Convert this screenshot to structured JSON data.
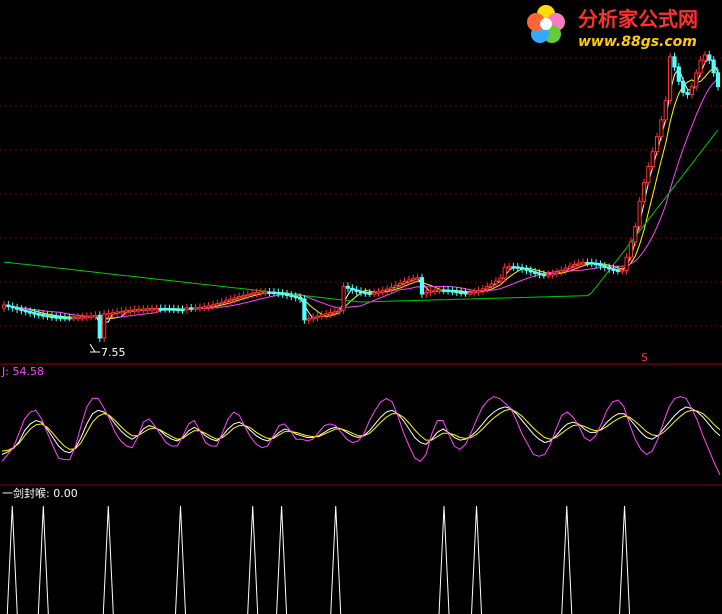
{
  "watermark": {
    "brand": "分析家公式网",
    "url": "www.88gs.com"
  },
  "chart_data": [
    {
      "type": "candlestick",
      "panel": "main",
      "grid": "horizontal dotted red",
      "annotations": [
        {
          "text": "7.55",
          "note": "low marker"
        },
        {
          "text": "S",
          "note": "signal marker"
        }
      ],
      "candles_count": 165,
      "ma_series": [
        {
          "color": "#ffffff"
        },
        {
          "color": "#ffff00"
        },
        {
          "color": "#ff44ff"
        },
        {
          "color": "#00cc00"
        }
      ],
      "colors": {
        "up": "#ff3030",
        "down": "#54ffff"
      }
    },
    {
      "type": "line",
      "panel": "kdj",
      "label": "J: 54.58",
      "series": [
        {
          "color": "#ffffff",
          "values": [
            30,
            33,
            37,
            45,
            58,
            66,
            70,
            68,
            60,
            50,
            40,
            34,
            32,
            38,
            50,
            66,
            78,
            82,
            80,
            75,
            66,
            58,
            52,
            48,
            52,
            60,
            64,
            62,
            58,
            52,
            48,
            46,
            50,
            58,
            62,
            58,
            52,
            48,
            46,
            52,
            60,
            66,
            68,
            64,
            58,
            52,
            48,
            46,
            50,
            56,
            60,
            58,
            54,
            52,
            50,
            50,
            52,
            56,
            60,
            62,
            60,
            56,
            52,
            50,
            52,
            58,
            66,
            74,
            80,
            82,
            78,
            70,
            60,
            50,
            44,
            42,
            48,
            56,
            60,
            56,
            50,
            47,
            48,
            52,
            58,
            66,
            74,
            80,
            84,
            86,
            84,
            78,
            70,
            62,
            54,
            48,
            44,
            46,
            52,
            60,
            66,
            68,
            66,
            60,
            56,
            56,
            60,
            68,
            74,
            78,
            78,
            72,
            64,
            56,
            50,
            48,
            52,
            60,
            68,
            76,
            82,
            86,
            84,
            80,
            74,
            66,
            58,
            52
          ]
        },
        {
          "color": "#ffff00",
          "values": [
            34,
            35,
            38,
            43,
            52,
            60,
            65,
            66,
            62,
            55,
            47,
            40,
            36,
            37,
            44,
            56,
            68,
            75,
            78,
            76,
            70,
            63,
            57,
            52,
            52,
            56,
            60,
            61,
            59,
            55,
            51,
            48,
            49,
            54,
            58,
            58,
            55,
            51,
            48,
            50,
            55,
            61,
            64,
            64,
            61,
            56,
            52,
            49,
            49,
            53,
            57,
            57,
            56,
            54,
            52,
            51,
            51,
            54,
            57,
            60,
            60,
            58,
            55,
            52,
            52,
            55,
            61,
            68,
            74,
            78,
            78,
            74,
            67,
            59,
            52,
            47,
            47,
            51,
            55,
            55,
            53,
            50,
            49,
            50,
            54,
            60,
            67,
            73,
            78,
            82,
            83,
            80,
            75,
            68,
            61,
            55,
            50,
            48,
            50,
            55,
            60,
            64,
            65,
            63,
            60,
            58,
            59,
            63,
            68,
            72,
            75,
            74,
            69,
            63,
            57,
            53,
            52,
            56,
            62,
            69,
            75,
            80,
            82,
            81,
            78,
            72,
            65,
            59
          ]
        },
        {
          "color": "#ff44ff",
          "values": [
            22,
            30,
            38,
            55,
            72,
            80,
            82,
            72,
            56,
            40,
            26,
            24,
            24,
            40,
            64,
            86,
            96,
            96,
            85,
            72,
            56,
            46,
            40,
            38,
            50,
            68,
            72,
            64,
            54,
            44,
            40,
            40,
            52,
            66,
            70,
            58,
            44,
            40,
            40,
            56,
            72,
            80,
            76,
            62,
            50,
            42,
            38,
            40,
            52,
            64,
            66,
            58,
            48,
            48,
            46,
            48,
            56,
            64,
            66,
            64,
            56,
            48,
            44,
            46,
            54,
            70,
            82,
            92,
            96,
            92,
            76,
            56,
            40,
            26,
            22,
            30,
            54,
            70,
            70,
            54,
            40,
            36,
            42,
            56,
            72,
            86,
            94,
            98,
            96,
            90,
            84,
            70,
            54,
            42,
            30,
            28,
            30,
            42,
            60,
            76,
            80,
            74,
            64,
            50,
            46,
            52,
            66,
            82,
            92,
            94,
            86,
            66,
            48,
            36,
            30,
            34,
            48,
            68,
            86,
            96,
            98,
            96,
            84,
            70,
            52,
            36,
            20,
            6
          ]
        }
      ]
    },
    {
      "type": "spike",
      "panel": "signal",
      "label": "一剑封喉: 0.00",
      "spikes_x_ratio": [
        0.017,
        0.06,
        0.15,
        0.25,
        0.35,
        0.39,
        0.465,
        0.615,
        0.66,
        0.785,
        0.865
      ]
    }
  ]
}
